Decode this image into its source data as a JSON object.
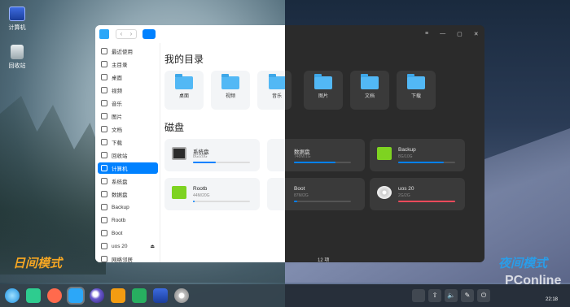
{
  "desktop": {
    "icons": [
      {
        "label": "计算机",
        "icon": "computer-icon"
      },
      {
        "label": "回收站",
        "icon": "trash-icon"
      }
    ],
    "mode_labels": {
      "day": "日间模式",
      "night": "夜间模式"
    },
    "watermark": "PConline"
  },
  "file_manager": {
    "sidebar": {
      "items": [
        {
          "label": "最近使用",
          "icon": "clock-icon"
        },
        {
          "label": "主目录",
          "icon": "home-icon"
        },
        {
          "label": "桌面",
          "icon": "desktop-icon"
        },
        {
          "label": "视频",
          "icon": "video-icon"
        },
        {
          "label": "音乐",
          "icon": "music-icon"
        },
        {
          "label": "图片",
          "icon": "picture-icon"
        },
        {
          "label": "文档",
          "icon": "document-icon"
        },
        {
          "label": "下载",
          "icon": "download-icon"
        },
        {
          "label": "回收站",
          "icon": "trash-icon"
        },
        {
          "label": "计算机",
          "icon": "computer-icon",
          "active": true
        },
        {
          "label": "系统盘",
          "icon": "disk-icon"
        },
        {
          "label": "数据盘",
          "icon": "disk-icon"
        },
        {
          "label": "Backup",
          "icon": "disk-icon"
        },
        {
          "label": "Rootb",
          "icon": "disk-icon"
        },
        {
          "label": "Boot",
          "icon": "disk-icon"
        },
        {
          "label": "uos 20",
          "icon": "disc-icon",
          "eject": "⏏"
        },
        {
          "label": "网络邻居",
          "icon": "network-icon"
        }
      ]
    },
    "my_directory": {
      "title": "我的目录",
      "folders": [
        "桌面",
        "视频",
        "音乐",
        "图片",
        "文档",
        "下载"
      ]
    },
    "disks": {
      "title": "磁盘",
      "items": [
        {
          "name": "系统盘",
          "size": "8G/20G",
          "used_fraction": 0.4,
          "color": "#0081ff"
        },
        {
          "name": "数据盘",
          "size": "748M/1G",
          "used_fraction": 0.73,
          "color": "#0081ff"
        },
        {
          "name": "Backup",
          "size": "8G/10G",
          "used_fraction": 0.8,
          "color": "#0081ff"
        },
        {
          "name": "Rootb",
          "size": "44M/20G",
          "used_fraction": 0.02,
          "color": "#0081ff"
        },
        {
          "name": "Boot",
          "size": "87M/2G",
          "used_fraction": 0.05,
          "color": "#0081ff"
        },
        {
          "name": "uos 20",
          "size": "2G/2G",
          "used_fraction": 1.0,
          "color": "#f04a5b"
        }
      ]
    },
    "status_bar": "12 项",
    "window_controls": [
      "≡",
      "—",
      "▢",
      "✕"
    ]
  },
  "taskbar": {
    "clock": "22:18",
    "tray": [
      "⇧",
      "🔈",
      "✎",
      "⏻"
    ]
  },
  "colors": {
    "accent": "#0081ff",
    "folder": "#52b8f5",
    "day_label": "#f5a623",
    "night_label": "#2a9de8"
  }
}
